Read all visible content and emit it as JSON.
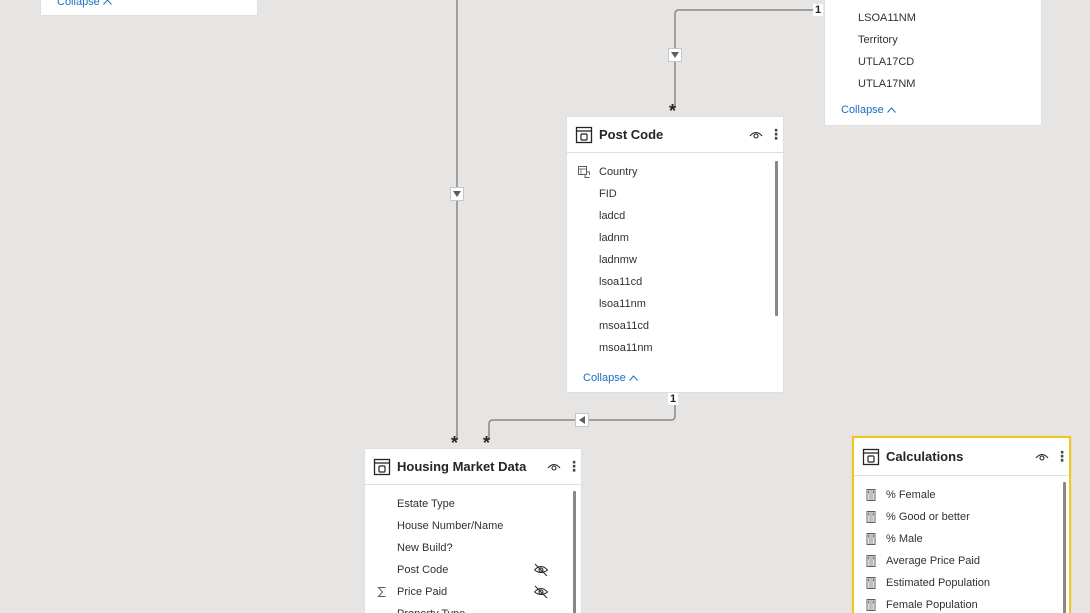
{
  "top_left_card": {
    "collapse_label": "Collapse"
  },
  "top_right_card": {
    "fields": [
      "LSOA11NM",
      "Territory",
      "UTLA17CD",
      "UTLA17NM"
    ],
    "collapse_label": "Collapse"
  },
  "post_code_card": {
    "title": "Post Code",
    "fields": [
      {
        "label": "Country",
        "icon": "hierarchy-icon"
      },
      {
        "label": "FID",
        "icon": ""
      },
      {
        "label": "ladcd",
        "icon": ""
      },
      {
        "label": "ladnm",
        "icon": ""
      },
      {
        "label": "ladnmw",
        "icon": ""
      },
      {
        "label": "lsoa11cd",
        "icon": ""
      },
      {
        "label": "lsoa11nm",
        "icon": ""
      },
      {
        "label": "msoa11cd",
        "icon": ""
      },
      {
        "label": "msoa11nm",
        "icon": ""
      }
    ],
    "collapse_label": "Collapse"
  },
  "housing_card": {
    "title": "Housing Market Data",
    "fields": [
      {
        "label": "Estate Type",
        "icon": "",
        "hidden": false
      },
      {
        "label": "House Number/Name",
        "icon": "",
        "hidden": false
      },
      {
        "label": "New Build?",
        "icon": "",
        "hidden": false
      },
      {
        "label": "Post Code",
        "icon": "",
        "hidden": true
      },
      {
        "label": "Price Paid",
        "icon": "sigma-icon",
        "hidden": true
      },
      {
        "label": "Property Type",
        "icon": "",
        "hidden": false
      }
    ]
  },
  "calculations_card": {
    "title": "Calculations",
    "fields": [
      {
        "label": "% Female",
        "icon": "calculator-icon"
      },
      {
        "label": "% Good or better",
        "icon": "calculator-icon"
      },
      {
        "label": "% Male",
        "icon": "calculator-icon"
      },
      {
        "label": "Average Price Paid",
        "icon": "calculator-icon"
      },
      {
        "label": "Estimated Population",
        "icon": "calculator-icon"
      },
      {
        "label": "Female Population",
        "icon": "calculator-icon"
      }
    ]
  },
  "relationships": {
    "one_label": "1",
    "many_label": "*"
  },
  "colors": {
    "canvas": "#e6e5e4",
    "link": "#1b6ec2",
    "selected_border": "#f2c811",
    "line": "#8a8886"
  }
}
